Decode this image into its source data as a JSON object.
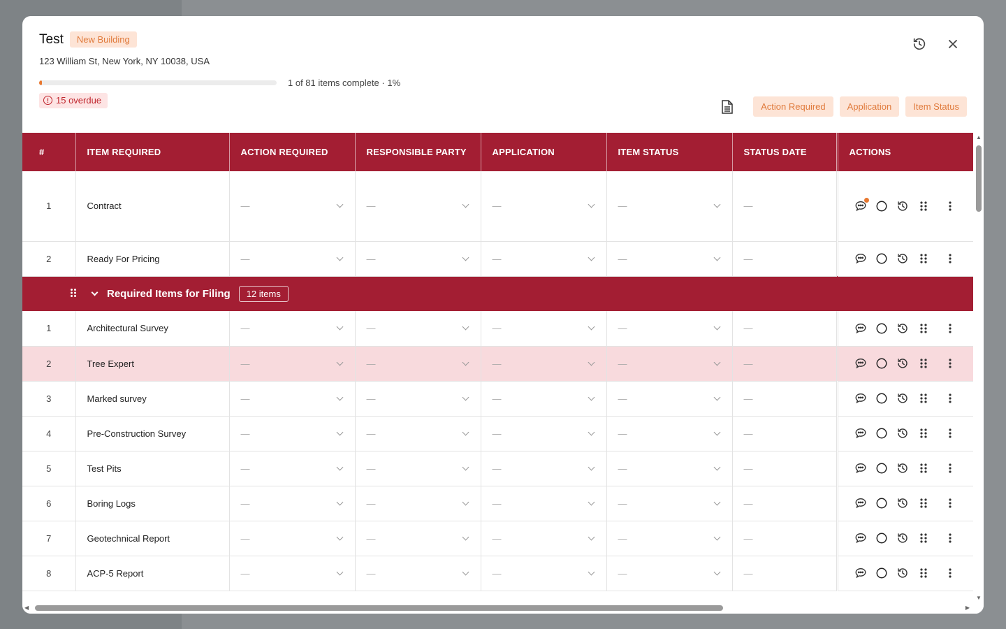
{
  "modal": {
    "title": "Test",
    "type_badge": "New Building",
    "address": "123 William St, New York, NY 10038, USA",
    "progress_fraction": 0.01,
    "progress_text": "1 of 81 items complete · 1%",
    "overdue_label": "15 overdue"
  },
  "header_icons": [
    "history-icon",
    "close-icon"
  ],
  "filters": [
    "Action Required",
    "Application",
    "Item Status"
  ],
  "colors": {
    "brand": "#a31e33",
    "accent": "#e8782f",
    "badge_bg": "#fde4d6",
    "highlight_row": "#f8dadd"
  },
  "columns": [
    "#",
    "ITEM REQUIRED",
    "ACTION REQUIRED",
    "RESPONSIBLE PARTY",
    "APPLICATION",
    "ITEM STATUS",
    "STATUS DATE",
    "ACTIONS"
  ],
  "empty_value": "—",
  "top_rows": [
    {
      "num": "1",
      "item": "Contract"
    },
    {
      "num": "2",
      "item": "Ready For Pricing"
    }
  ],
  "group": {
    "title": "Required Items for Filing",
    "count": "12 items",
    "rows": [
      {
        "num": "1",
        "item": "Architectural Survey"
      },
      {
        "num": "2",
        "item": "Tree Expert"
      },
      {
        "num": "3",
        "item": "Marked survey"
      },
      {
        "num": "4",
        "item": "Pre-Construction Survey"
      },
      {
        "num": "5",
        "item": "Test Pits"
      },
      {
        "num": "6",
        "item": "Boring Logs"
      },
      {
        "num": "7",
        "item": "Geotechnical Report"
      },
      {
        "num": "8",
        "item": "ACP-5 Report"
      }
    ]
  },
  "row_action_icons": [
    "comment-icon",
    "status-circle-icon",
    "history-icon",
    "drag-handle-icon",
    "more-vertical-icon"
  ]
}
